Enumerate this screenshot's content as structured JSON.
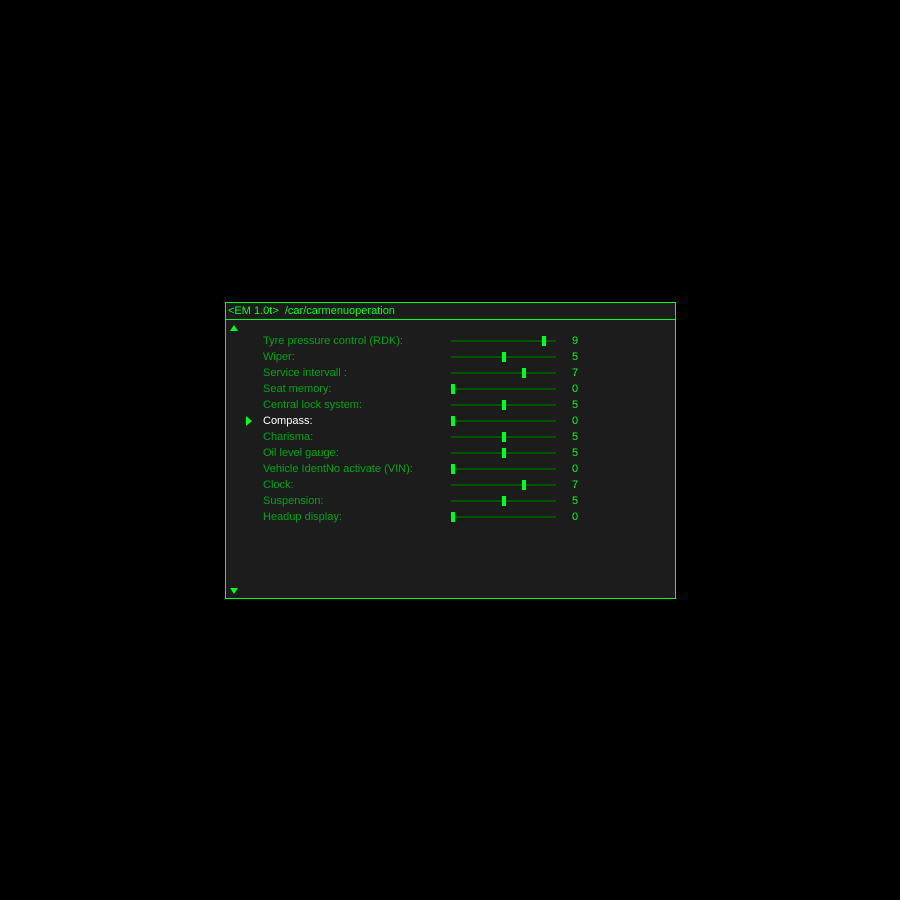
{
  "title": "<EM 1.0t>  /car/carmenuoperation",
  "slider": {
    "max": 10
  },
  "selected_index": 5,
  "rows": [
    {
      "label": "Tyre pressure control (RDK):",
      "value": 9
    },
    {
      "label": "Wiper:",
      "value": 5
    },
    {
      "label": "Service intervall :",
      "value": 7
    },
    {
      "label": "Seat memory:",
      "value": 0
    },
    {
      "label": "Central lock system:",
      "value": 5
    },
    {
      "label": "Compass:",
      "value": 0
    },
    {
      "label": "Charisma:",
      "value": 5
    },
    {
      "label": "Oil level gauge:",
      "value": 5
    },
    {
      "label": "Vehicle IdentNo activate (VIN):",
      "value": 0
    },
    {
      "label": "Clock:",
      "value": 7
    },
    {
      "label": "Suspension:",
      "value": 5
    },
    {
      "label": "Headup display:",
      "value": 0
    }
  ]
}
